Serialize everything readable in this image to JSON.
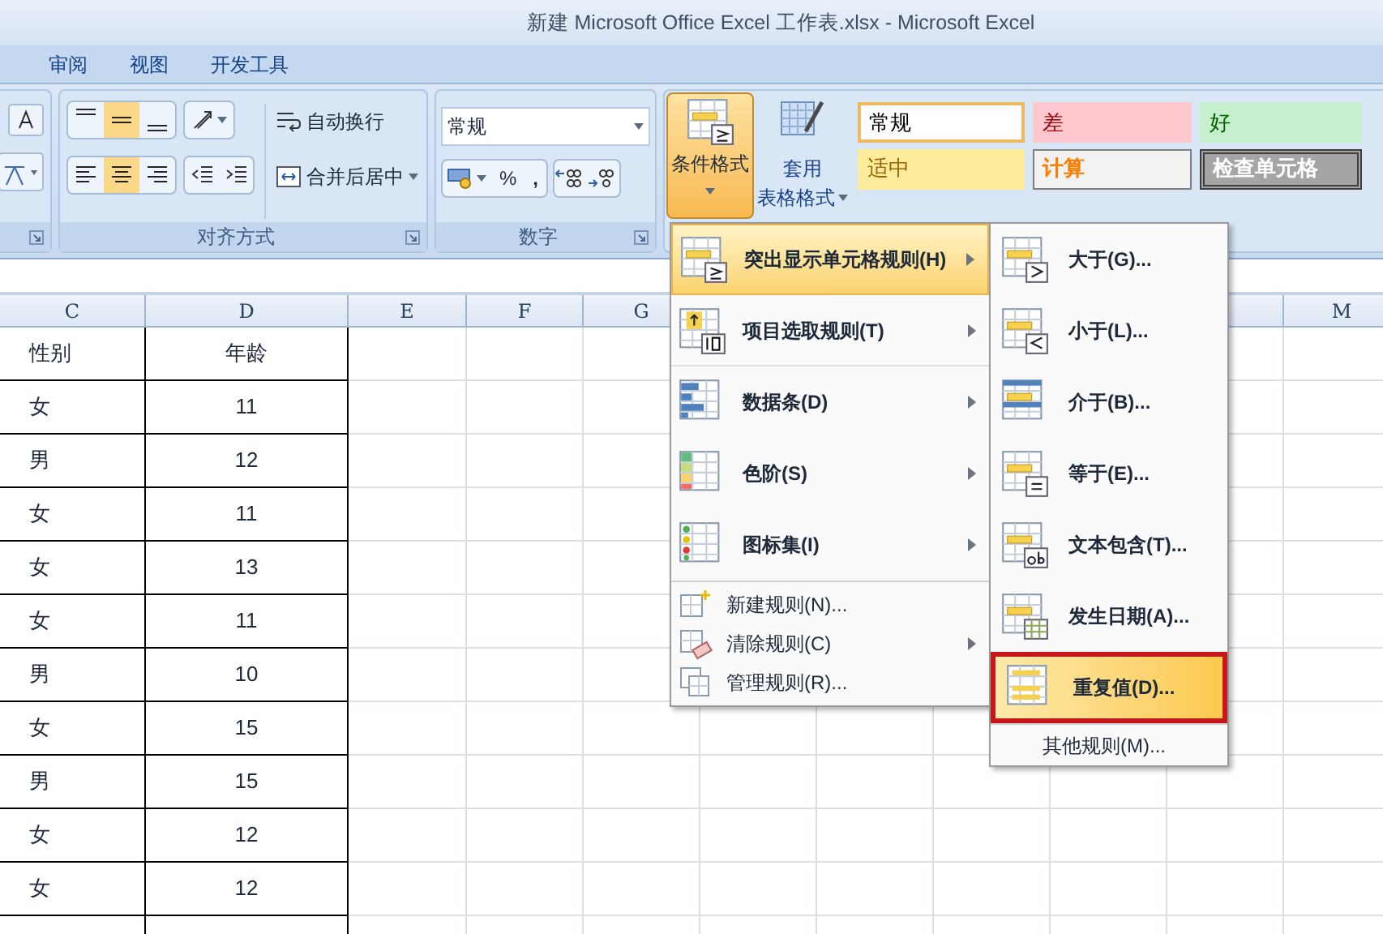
{
  "window": {
    "title": "新建 Microsoft Office Excel 工作表.xlsx - Microsoft Excel"
  },
  "ribbon_tabs": [
    {
      "label": "审阅",
      "selected": false
    },
    {
      "label": "视图",
      "selected": false
    },
    {
      "label": "开发工具",
      "selected": false
    }
  ],
  "alignment_group": {
    "label": "对齐方式",
    "vertical_align": [
      {
        "selected": false
      },
      {
        "selected": true
      },
      {
        "selected": false
      }
    ],
    "horizontal_align": [
      {
        "selected": false
      },
      {
        "selected": true
      },
      {
        "selected": false
      }
    ],
    "wrap_text": "自动换行",
    "merge_center": "合并后居中"
  },
  "number_group": {
    "label": "数字",
    "format": "常规",
    "percent": "%",
    "comma": ","
  },
  "styles_group": {
    "conditional_format": {
      "label": "条件格式",
      "expanded": true
    },
    "table_format": {
      "line_1": "套用",
      "line_2": "表格格式"
    },
    "cell_styles": [
      {
        "label": "常规",
        "kind": "normal"
      },
      {
        "label": "差",
        "kind": "bad"
      },
      {
        "label": "好",
        "kind": "good"
      },
      {
        "label": "适中",
        "kind": "neutral"
      },
      {
        "label": "计算",
        "kind": "calculation"
      },
      {
        "label": "检查单元格",
        "kind": "check"
      }
    ]
  },
  "conditional_format_menu": {
    "items": [
      {
        "label": "突出显示单元格规则(H)",
        "kind": "highlight",
        "submenu": true,
        "selected": true
      },
      {
        "label": "项目选取规则(T)",
        "kind": "top10",
        "submenu": true,
        "selected": false
      },
      {
        "label": "数据条(D)",
        "kind": "databar",
        "submenu": true,
        "selected": false
      },
      {
        "label": "色阶(S)",
        "kind": "colorscale",
        "submenu": true,
        "selected": false
      },
      {
        "label": "图标集(I)",
        "kind": "iconset",
        "submenu": true,
        "selected": false
      }
    ],
    "small_items": [
      {
        "label": "新建规则(N)...",
        "kind": "new",
        "submenu": false
      },
      {
        "label": "清除规则(C)",
        "kind": "clear",
        "submenu": true
      },
      {
        "label": "管理规则(R)...",
        "kind": "manage",
        "submenu": false
      }
    ]
  },
  "highlight_submenu": {
    "items": [
      {
        "label": "大于(G)...",
        "kind": "greater",
        "selected": false,
        "framed": false
      },
      {
        "label": "小于(L)...",
        "kind": "less",
        "selected": false,
        "framed": false
      },
      {
        "label": "介于(B)...",
        "kind": "between",
        "selected": false,
        "framed": false
      },
      {
        "label": "等于(E)...",
        "kind": "equal",
        "selected": false,
        "framed": false
      },
      {
        "label": "文本包含(T)...",
        "kind": "text",
        "selected": false,
        "framed": false
      },
      {
        "label": "发生日期(A)...",
        "kind": "date",
        "selected": false,
        "framed": false
      },
      {
        "label": "重复值(D)...",
        "kind": "duplicate",
        "selected": true,
        "framed": true
      }
    ],
    "more": "其他规则(M)..."
  },
  "sheet": {
    "columns": [
      "C",
      "D",
      "E",
      "F",
      "G",
      "M"
    ],
    "header": [
      "性别",
      "年龄"
    ],
    "rows": [
      [
        "女",
        "11"
      ],
      [
        "男",
        "12"
      ],
      [
        "女",
        "11"
      ],
      [
        "女",
        "13"
      ],
      [
        "女",
        "11"
      ],
      [
        "男",
        "10"
      ],
      [
        "女",
        "15"
      ],
      [
        "男",
        "15"
      ],
      [
        "女",
        "12"
      ],
      [
        "女",
        "12"
      ]
    ]
  }
}
